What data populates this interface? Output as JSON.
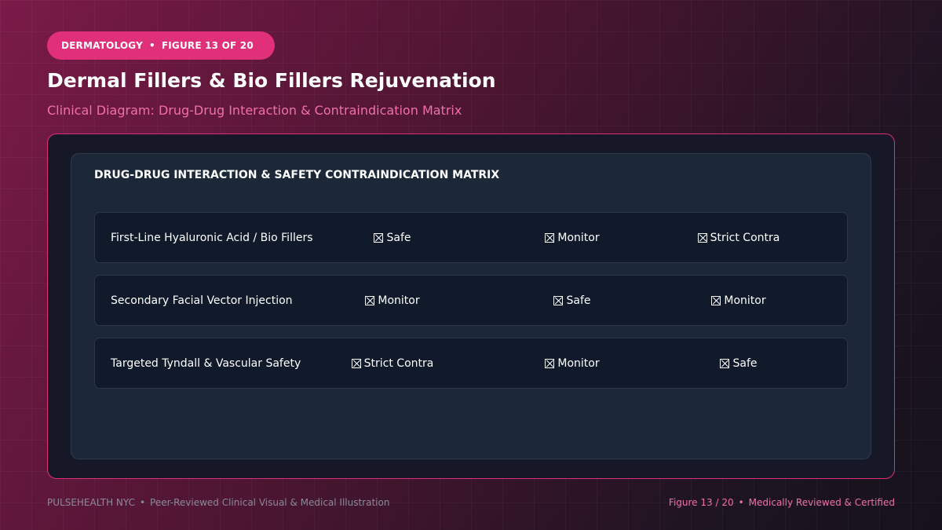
{
  "header": {
    "category": "DERMATOLOGY",
    "figure_tag": "FIGURE 13 OF 20",
    "title": "Dermal Fillers & Bio Fillers Rejuvenation",
    "subtitle": "Clinical Diagram: Drug-Drug Interaction & Contraindication Matrix"
  },
  "matrix": {
    "title": "DRUG-DRUG INTERACTION & SAFETY CONTRAINDICATION MATRIX",
    "rows": [
      {
        "label": "First-Line Hyaluronic Acid / Bio Fillers",
        "cells": [
          "Safe",
          "Monitor",
          "Strict Contra"
        ]
      },
      {
        "label": "Secondary Facial Vector Injection",
        "cells": [
          "Monitor",
          "Safe",
          "Monitor"
        ]
      },
      {
        "label": "Targeted Tyndall & Vascular Safety",
        "cells": [
          "Strict Contra",
          "Monitor",
          "Safe"
        ]
      }
    ]
  },
  "footer": {
    "brand": "PULSEHEALTH NYC",
    "left_text": "Peer-Reviewed Clinical Visual & Medical Illustration",
    "figure_count": "Figure 13 / 20",
    "right_text": "Medically Reviewed & Certified"
  },
  "colors": {
    "accent": "#e0307a",
    "accent_text": "#f070a8",
    "panel_bg": "#1c2838",
    "row_bg": "#101a2a"
  }
}
